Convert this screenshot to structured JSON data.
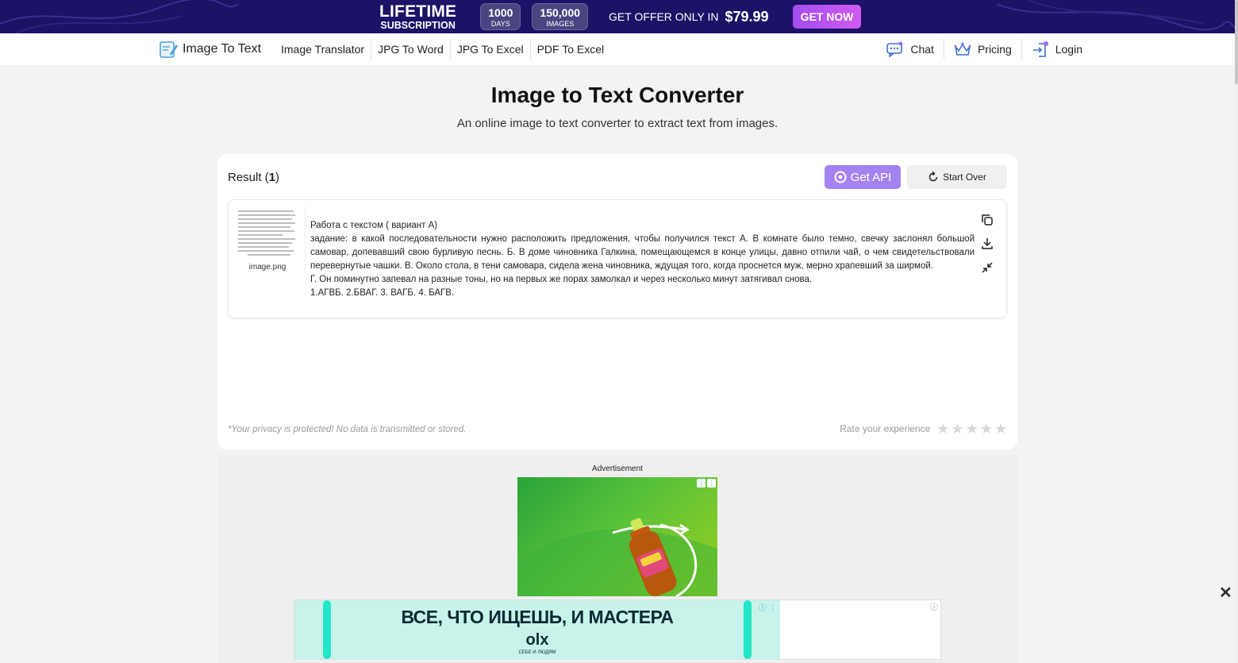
{
  "promo": {
    "lifetime_big": "LIFETIME",
    "lifetime_small": "SUBSCRIPTION",
    "days_value": "1000",
    "days_label": "DAYS",
    "images_value": "150,000",
    "images_label": "IMAGES",
    "offer_text": "GET OFFER ONLY IN",
    "price": "$79.99",
    "cta": "GET NOW"
  },
  "nav": {
    "logo_text": "Image To Text",
    "links": [
      "Image Translator",
      "JPG To Word",
      "JPG To Excel",
      "PDF To Excel"
    ],
    "chat": "Chat",
    "pricing": "Pricing",
    "login": "Login"
  },
  "hero": {
    "title": "Image to Text Converter",
    "subtitle": "An online image to text converter to extract text from images."
  },
  "result": {
    "label_prefix": "Result (",
    "count": "1",
    "label_suffix": ")",
    "get_api": "Get API",
    "start_over": "Start Over",
    "file_name": "image.png",
    "lines": [
      "Работа с текстом ( вариант А)",
      "задание: в какой последовательности нужно расположить предложения, чтобы получился текст А. В комнате было темно, свечку заслонял большой самовар, допевавший свою бурливую песнь. Б. В доме чиновника Галкина, помещающемся в конце улицы, давно отпили чай, о чем свидетельствовали перевернутые чашки. В. Около стола, в тени самовара, сидела жена чиновника, ждущая того, когда проснется муж, мерно храпевший за ширмой.",
      "Г. Он поминутно запевал на разные тоны, но на первых же порах замолкал и через несколько минут затягивал снова.",
      "1.АГВБ. 2.БВАГ. 3. ВАГБ. 4. БАГВ."
    ],
    "privacy": "*Your privacy is protected! No data is transmitted or stored.",
    "rate_label": "Rate your experience",
    "rating": 0
  },
  "ads": {
    "label": "Advertisement",
    "bottom_headline": "ВСЕ, ЧТО ИЩЕШЬ, И МАСТЕРА",
    "bottom_brand": "olx",
    "bottom_tagline": "СЕБЕ И ЛЮДЯМ",
    "close": "✕"
  },
  "colors": {
    "promo_bg": "#1c1266",
    "accent": "#a582f2",
    "cta_gradient": "#a34df0"
  }
}
